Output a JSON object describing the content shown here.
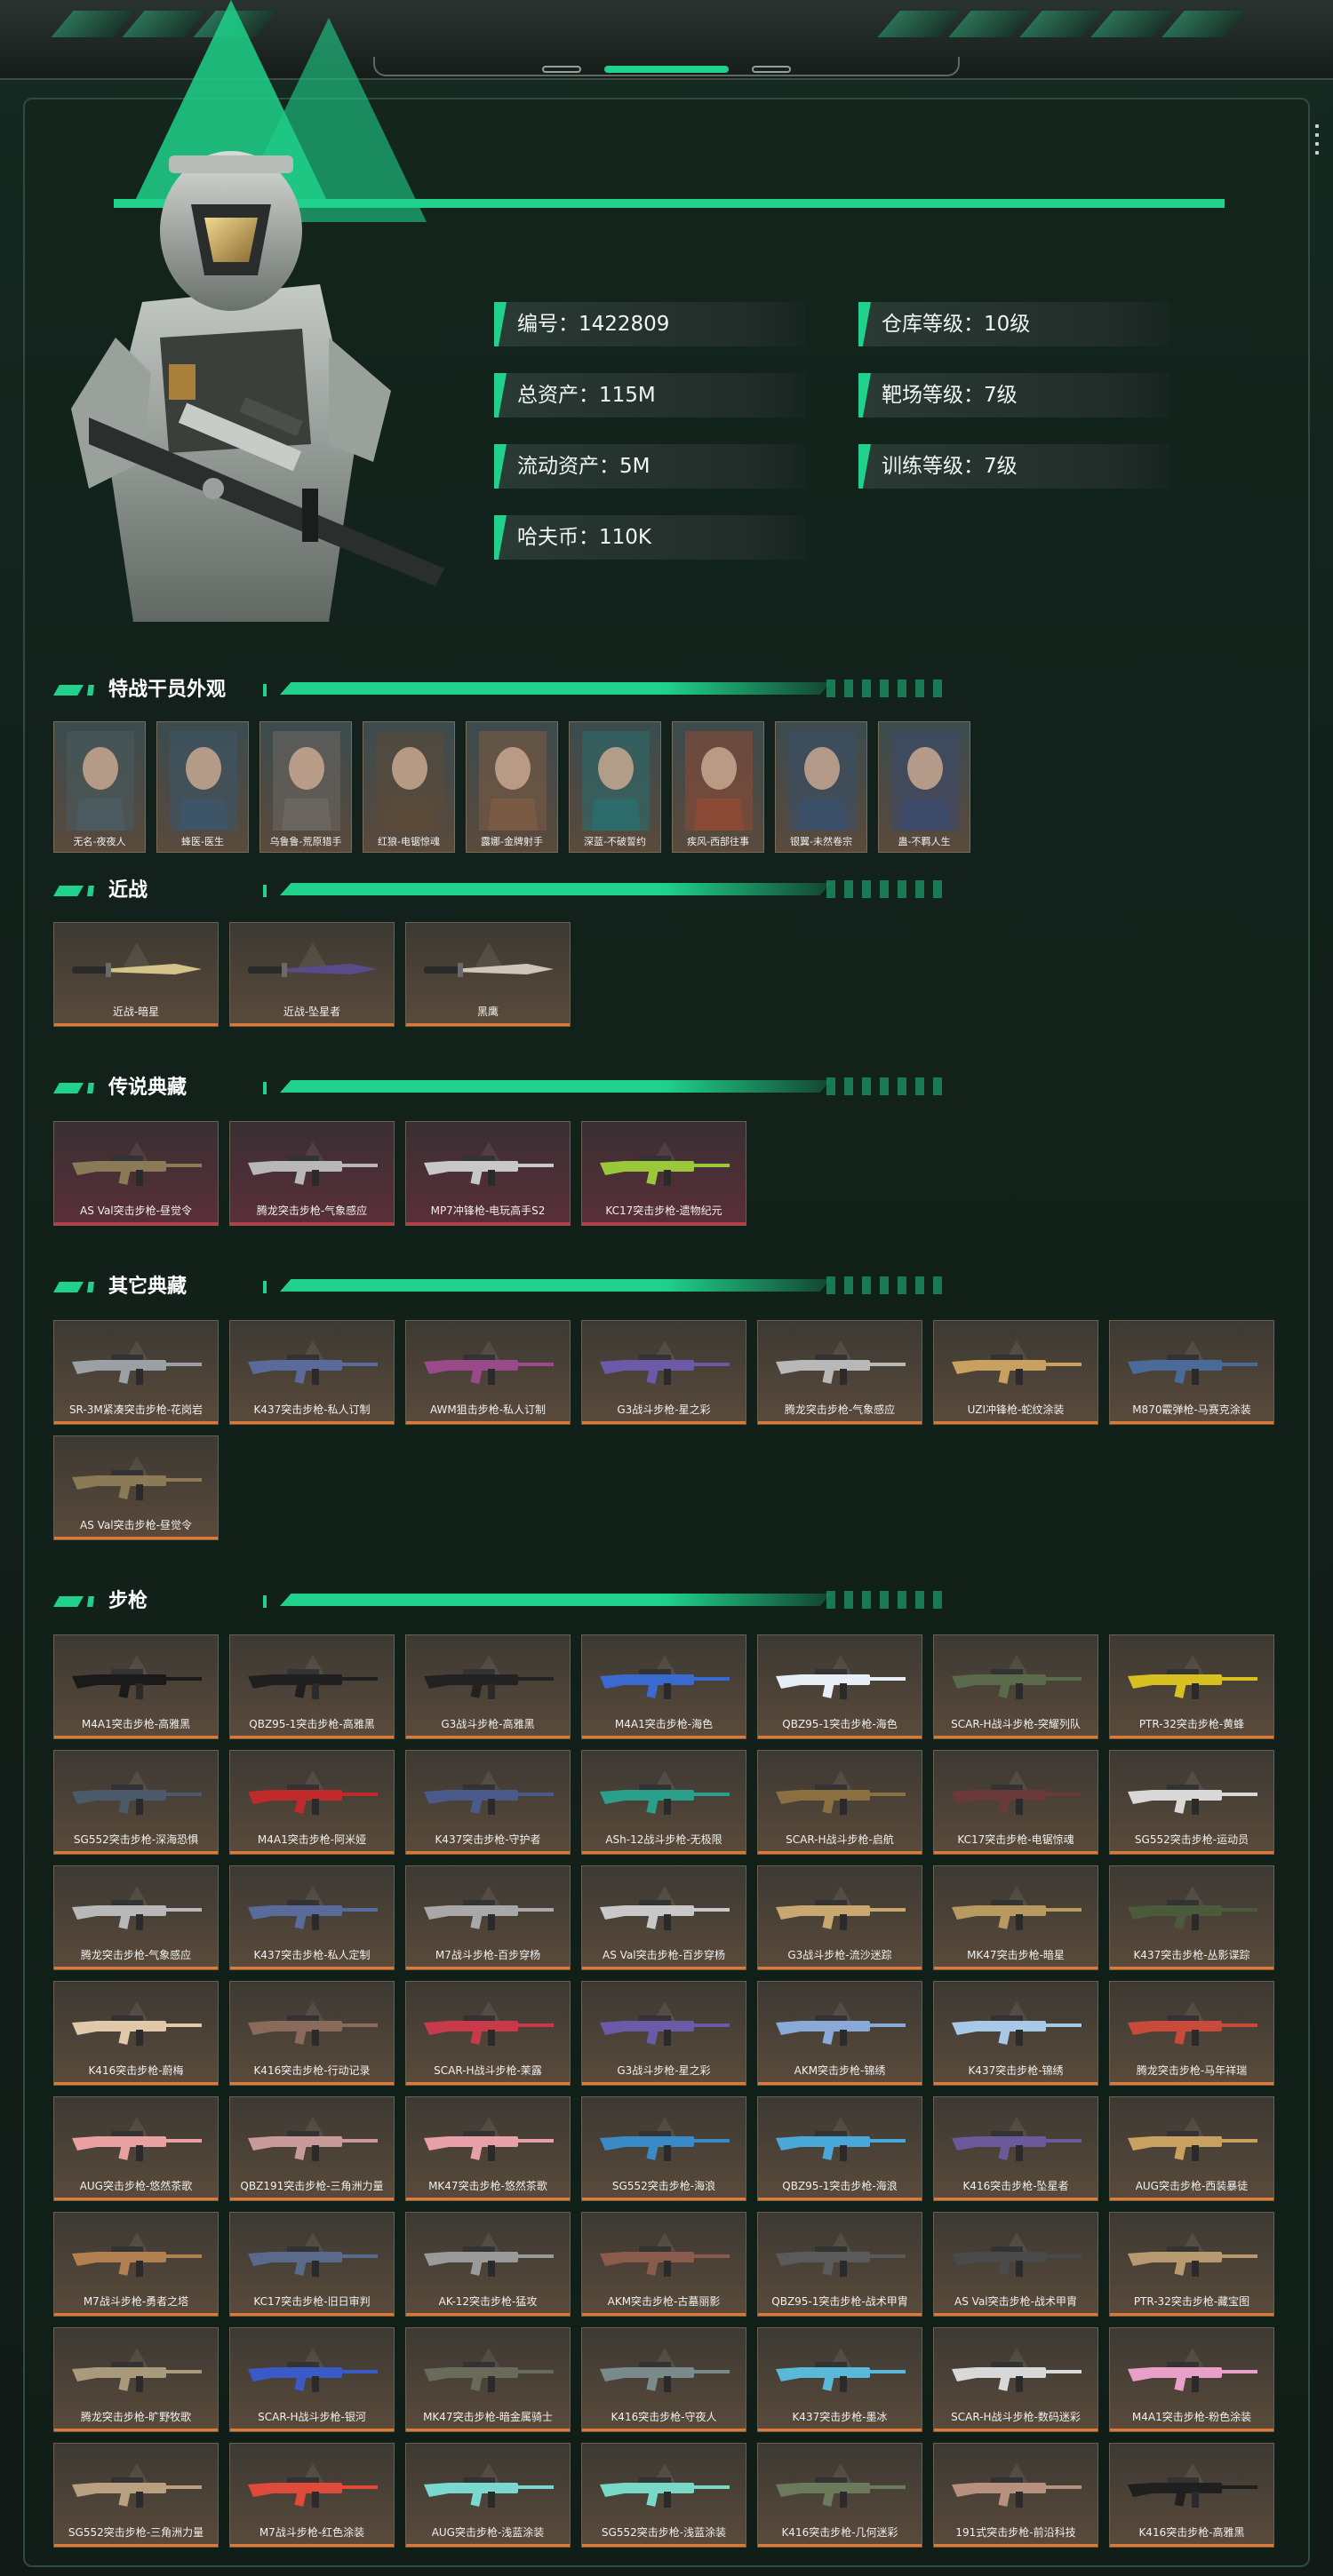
{
  "profile": {
    "stats": [
      {
        "label": "编号：1422809"
      },
      {
        "label": "仓库等级：10级"
      },
      {
        "label": "总资产：115M"
      },
      {
        "label": "靶场等级：7级"
      },
      {
        "label": "流动资产：5M"
      },
      {
        "label": "训练等级：7级"
      },
      {
        "label": "哈夫币：110K"
      }
    ]
  },
  "colors": {
    "accent": "#1fd18a",
    "normal_rarity": "#e07a32",
    "legend_rarity": "#c23a48"
  },
  "sections": {
    "operators": {
      "title": "特战干员外观",
      "items": [
        {
          "label": "无名-夜夜人",
          "color": "#4a5a5e"
        },
        {
          "label": "蜂医-医生",
          "color": "#3d5566"
        },
        {
          "label": "乌鲁鲁-荒原猎手",
          "color": "#6a6560"
        },
        {
          "label": "红狼-电锯惊魂",
          "color": "#5a4a3a"
        },
        {
          "label": "露娜-金牌射手",
          "color": "#7a5a45"
        },
        {
          "label": "深蓝-不破誓约",
          "color": "#2d6a6a"
        },
        {
          "label": "疾风-西部往事",
          "color": "#8a4a35"
        },
        {
          "label": "银翼-未然卷宗",
          "color": "#3a4e68"
        },
        {
          "label": "蛊-不羁人生",
          "color": "#3d4a6a"
        }
      ]
    },
    "melee": {
      "title": "近战",
      "items": [
        {
          "label": "近战-暗星",
          "color": "#d4c48a"
        },
        {
          "label": "近战-坠星者",
          "color": "#5a4a8a"
        },
        {
          "label": "黑鹰",
          "color": "#cfc6b8"
        }
      ]
    },
    "legendary": {
      "title": "传说典藏",
      "items": [
        {
          "label": "AS Val突击步枪-昼觉令",
          "color": "#8a7a55"
        },
        {
          "label": "腾龙突击步枪-气象感应",
          "color": "#b8b8b8"
        },
        {
          "label": "MP7冲锋枪-电玩高手S2",
          "color": "#c8c8c8"
        },
        {
          "label": "KC17突击步枪-遗物纪元",
          "color": "#9ac83a"
        }
      ]
    },
    "other": {
      "title": "其它典藏",
      "items": [
        {
          "label": "SR-3M紧凑突击步枪-花岗岩",
          "color": "#9aa0a4"
        },
        {
          "label": "K437突击步枪-私人订制",
          "color": "#5a6a9a"
        },
        {
          "label": "AWM狙击步枪-私人订制",
          "color": "#9a4a8a"
        },
        {
          "label": "G3战斗步枪-星之彩",
          "color": "#6a5aa8"
        },
        {
          "label": "腾龙突击步枪-气象感应",
          "color": "#b8b8b8"
        },
        {
          "label": "UZI冲锋枪-蛇纹涂装",
          "color": "#c8a060"
        },
        {
          "label": "M870霰弹枪-马赛克涂装",
          "color": "#4a6a9a"
        },
        {
          "label": "AS Val突击步枪-昼觉令",
          "color": "#8a7a55"
        }
      ]
    },
    "rifles": {
      "title": "步枪",
      "items": [
        {
          "label": "M4A1突击步枪-高雅黑",
          "color": "#1a1a1a"
        },
        {
          "label": "QBZ95-1突击步枪-高雅黑",
          "color": "#1f1f1f"
        },
        {
          "label": "G3战斗步枪-高雅黑",
          "color": "#222222"
        },
        {
          "label": "M4A1突击步枪-海色",
          "color": "#3a6ad0"
        },
        {
          "label": "QBZ95-1突击步枪-海色",
          "color": "#e8eef5"
        },
        {
          "label": "SCAR-H战斗步枪-突耀列队",
          "color": "#5a6a4a"
        },
        {
          "label": "PTR-32突击步枪-黄蜂",
          "color": "#d8c020"
        },
        {
          "label": "SG552突击步枪-深海恐惧",
          "color": "#4a5a6a"
        },
        {
          "label": "M4A1突击步枪-阿米娅",
          "color": "#c02a2a"
        },
        {
          "label": "K437突击步枪-守护者",
          "color": "#4a5a8a"
        },
        {
          "label": "ASh-12战斗步枪-无极限",
          "color": "#2aa08a"
        },
        {
          "label": "SCAR-H战斗步枪-启航",
          "color": "#8a7040"
        },
        {
          "label": "KC17突击步枪-电锯惊魂",
          "color": "#6a3a3a"
        },
        {
          "label": "SG552突击步枪-运动员",
          "color": "#d8d8d8"
        },
        {
          "label": "腾龙突击步枪-气象感应",
          "color": "#b8b8b8"
        },
        {
          "label": "K437突击步枪-私人定制",
          "color": "#5a6a9a"
        },
        {
          "label": "M7战斗步枪-百步穿杨",
          "color": "#a8a8a8"
        },
        {
          "label": "AS Val突击步枪-百步穿杨",
          "color": "#c8c8c8"
        },
        {
          "label": "G3战斗步枪-流沙迷踪",
          "color": "#c8a870"
        },
        {
          "label": "MK47突击步枪-暗星",
          "color": "#b89a60"
        },
        {
          "label": "K437突击步枪-丛影谍踪",
          "color": "#4a5a3a"
        },
        {
          "label": "K416突击步枪-蔚梅",
          "color": "#e0c8a8"
        },
        {
          "label": "K416突击步枪-行动记录",
          "color": "#8a6a5a"
        },
        {
          "label": "SCAR-H战斗步枪-茉露",
          "color": "#c83a4a"
        },
        {
          "label": "G3战斗步枪-星之彩",
          "color": "#6a5aa8"
        },
        {
          "label": "AKM突击步枪-锦绣",
          "color": "#8aa8d8"
        },
        {
          "label": "K437突击步枪-锦绣",
          "color": "#a8c8e8"
        },
        {
          "label": "腾龙突击步枪-马年祥瑞",
          "color": "#c84a3a"
        },
        {
          "label": "AUG突击步枪-悠然茶歌",
          "color": "#e8a0a0"
        },
        {
          "label": "QBZ191突击步枪-三角洲力量",
          "color": "#c89a9a"
        },
        {
          "label": "MK47突击步枪-悠然茶歌",
          "color": "#e8a0a8"
        },
        {
          "label": "SG552突击步枪-海浪",
          "color": "#3a8ac8"
        },
        {
          "label": "QBZ95-1突击步枪-海浪",
          "color": "#4aa8d8"
        },
        {
          "label": "K416突击步枪-坠星者",
          "color": "#6a5a9a"
        },
        {
          "label": "AUG突击步枪-西装暴徒",
          "color": "#c8a060"
        },
        {
          "label": "M7战斗步枪-勇者之塔",
          "color": "#b08050"
        },
        {
          "label": "KC17突击步枪-旧日审判",
          "color": "#5a6a8a"
        },
        {
          "label": "AK-12突击步枪-猛攻",
          "color": "#9a9a9a"
        },
        {
          "label": "AKM突击步枪-古墓丽影",
          "color": "#8a5a4a"
        },
        {
          "label": "QBZ95-1突击步枪-战术甲胄",
          "color": "#5a5a5a"
        },
        {
          "label": "AS Val突击步枪-战术甲胄",
          "color": "#4a4a4a"
        },
        {
          "label": "PTR-32突击步枪-藏宝图",
          "color": "#b89a70"
        },
        {
          "label": "腾龙突击步枪-旷野牧歌",
          "color": "#a89a7a"
        },
        {
          "label": "SCAR-H战斗步枪-银河",
          "color": "#3a5ac8"
        },
        {
          "label": "MK47突击步枪-暗金属骑士",
          "color": "#6a6a5a"
        },
        {
          "label": "K416突击步枪-守夜人",
          "color": "#7a8a8a"
        },
        {
          "label": "K437突击步枪-墨冰",
          "color": "#5ab8d8"
        },
        {
          "label": "SCAR-H战斗步枪-数码迷彩",
          "color": "#d8d8d8"
        },
        {
          "label": "M4A1突击步枪-粉色涂装",
          "color": "#e8a0c8"
        },
        {
          "label": "SG552突击步枪-三角洲力量",
          "color": "#b8a080"
        },
        {
          "label": "M7战斗步枪-红色涂装",
          "color": "#e04a3a"
        },
        {
          "label": "AUG突击步枪-浅蓝涂装",
          "color": "#7ad8d0"
        },
        {
          "label": "SG552突击步枪-浅蓝涂装",
          "color": "#7ad8c8"
        },
        {
          "label": "K416突击步枪-几何迷彩",
          "color": "#6a7a5a"
        },
        {
          "label": "191式突击步枪-前沿科技",
          "color": "#b89080"
        },
        {
          "label": "K416突击步枪-高雅黑",
          "color": "#1f1f1f"
        }
      ]
    }
  }
}
